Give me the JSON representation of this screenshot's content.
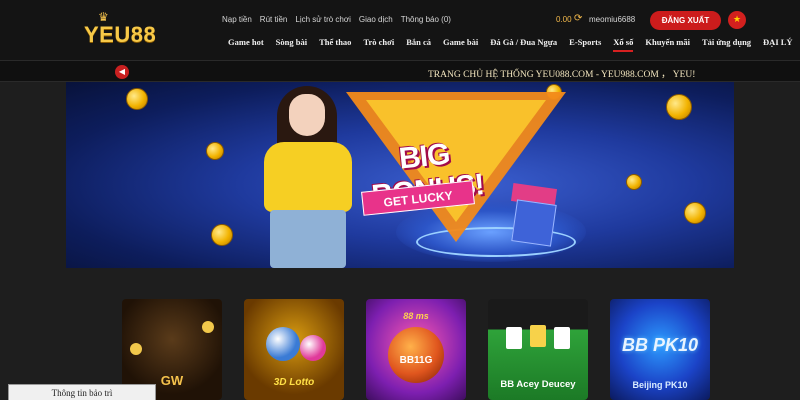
{
  "header": {
    "logo_text": "YEU88",
    "top_links": [
      "Nạp tiền",
      "Rút tiền",
      "Lịch sử trò chơi",
      "Giao dịch",
      "Thông báo (0)"
    ],
    "balance": "0.00",
    "username": "meomiu6688",
    "logout_label": "ĐĂNG XUẤT",
    "nav": [
      {
        "label": "Game hot",
        "active": false
      },
      {
        "label": "Sòng bài",
        "active": false
      },
      {
        "label": "Thể thao",
        "active": false
      },
      {
        "label": "Trò chơi",
        "active": false
      },
      {
        "label": "Bắn cá",
        "active": false
      },
      {
        "label": "Game bài",
        "active": false
      },
      {
        "label": "Đá Gà / Đua Ngựa",
        "active": false
      },
      {
        "label": "E-Sports",
        "active": false
      },
      {
        "label": "Xổ số",
        "active": true
      },
      {
        "label": "Khuyến mãi",
        "active": false
      },
      {
        "label": "Tải ứng dụng",
        "active": false
      },
      {
        "label": "ĐẠI LÝ",
        "active": false
      }
    ]
  },
  "marquee": {
    "text": "TRANG CHỦ HỆ THỐNG YEU088.COM - YEU988.COM ，  YEU!"
  },
  "banner": {
    "headline": "BIG BONUS!",
    "subline": "GET LUCKY"
  },
  "games": [
    {
      "label": "GW"
    },
    {
      "label": "3D Lotto"
    },
    {
      "label_top": "88 ms",
      "label": "BB11G"
    },
    {
      "label": "BB Acey Deucey"
    },
    {
      "label_big": "BB PK10",
      "label": "Beijing PK10"
    }
  ],
  "maintenance": {
    "label": "Thông tin bảo trì"
  },
  "colors": {
    "accent_red": "#cc1c1c",
    "gold": "#f7c948",
    "background": "#1e1e1e"
  }
}
